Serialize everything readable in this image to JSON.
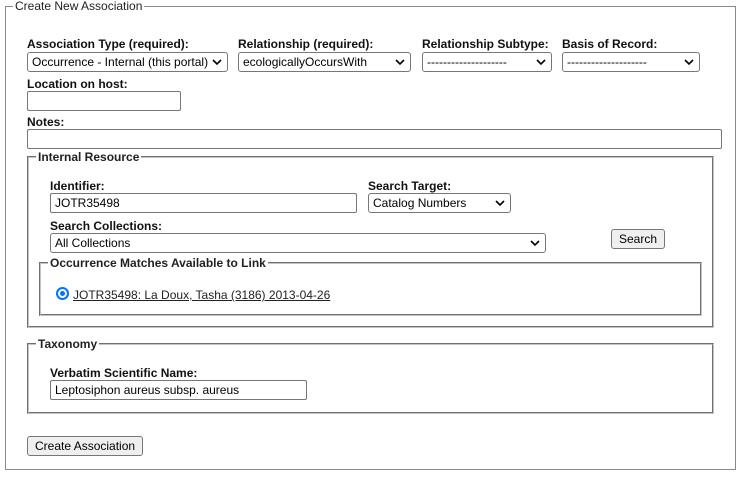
{
  "form": {
    "legend": "Create New Association",
    "association_type": {
      "label": "Association Type (required):",
      "value": "Occurrence - Internal (this portal)"
    },
    "relationship": {
      "label": "Relationship (required):",
      "value": "ecologicallyOccursWith"
    },
    "relationship_subtype": {
      "label": "Relationship Subtype:",
      "value": "--------------------"
    },
    "basis_of_record": {
      "label": "Basis of Record:",
      "value": "--------------------"
    },
    "location_on_host": {
      "label": "Location on host:",
      "value": ""
    },
    "notes": {
      "label": "Notes:",
      "value": ""
    },
    "internal_resource": {
      "legend": "Internal Resource",
      "identifier": {
        "label": "Identifier:",
        "value": "JOTR35498"
      },
      "search_target": {
        "label": "Search Target:",
        "value": "Catalog Numbers"
      },
      "search_collections": {
        "label": "Search Collections:",
        "value": "All Collections"
      },
      "search_button": "Search",
      "matches": {
        "legend": "Occurrence Matches Available to Link",
        "items": [
          {
            "text": "JOTR35498: La Doux, Tasha (3186) 2013-04-26",
            "selected": true
          }
        ]
      }
    },
    "taxonomy": {
      "legend": "Taxonomy",
      "verbatim_name": {
        "label": "Verbatim Scientific Name:",
        "value": "Leptosiphon aureus subsp. aureus"
      }
    },
    "submit_label": "Create Association"
  },
  "icons": {
    "select_arrow": "chevron-down-icon",
    "radio": "radio-selected"
  },
  "colors": {
    "radio_accent": "#0075ff",
    "border": "#767676",
    "button_bg": "#efefef"
  }
}
